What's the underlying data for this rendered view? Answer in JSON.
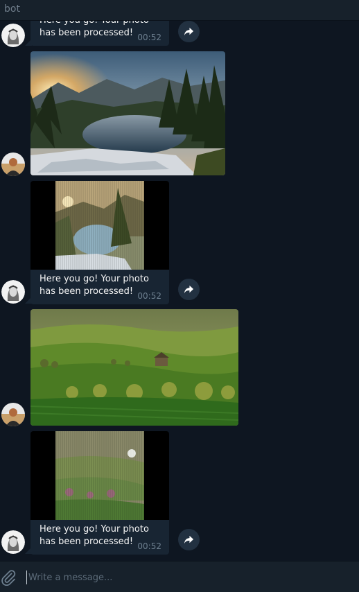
{
  "header": {
    "title": "bot"
  },
  "messages": [
    {
      "text": "Here you go! Your photo has been processed!",
      "time": "00:52"
    },
    {
      "text": "Here you go! Your photo has been processed!",
      "time": "00:52"
    },
    {
      "text": "Here you go! Your photo has been processed!",
      "time": "00:52"
    }
  ],
  "composer": {
    "placeholder": "Write a message..."
  },
  "icons": {
    "share": "share-arrow-icon",
    "attach": "paperclip-icon"
  },
  "colors": {
    "background": "#0e1621",
    "bubble": "#182533",
    "panel": "#17212b",
    "time": "#6d7f8f"
  }
}
